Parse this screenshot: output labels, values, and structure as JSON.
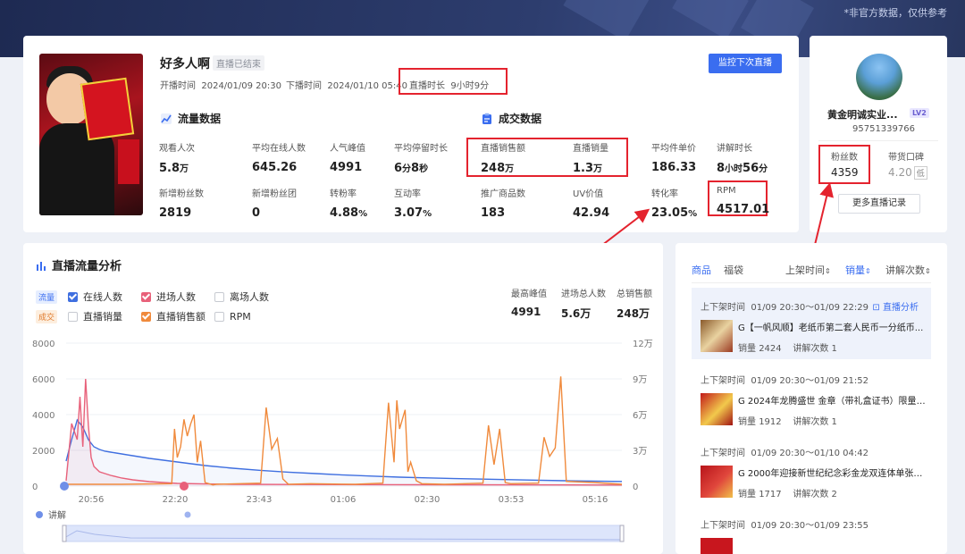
{
  "top_note": "*非官方数据，仅供参考",
  "live": {
    "title": "好多人啊",
    "status": "直播已结束",
    "start_label": "开播时间",
    "start": "2024/01/09 20:30",
    "end_label": "下播时间",
    "end": "2024/01/10 05:40",
    "duration_label": "直播时长",
    "duration": "9小时9分",
    "monitor_button": "监控下次直播"
  },
  "traffic": {
    "title": "流量数据",
    "stats": [
      {
        "label": "观看人次",
        "num": "5.8",
        "unit": "万"
      },
      {
        "label": "平均在线人数",
        "num": "645.26",
        "unit": ""
      },
      {
        "label": "人气峰值",
        "num": "4991",
        "unit": ""
      },
      {
        "label": "平均停留时长",
        "num": "6",
        "unit": "分",
        "num2": "8",
        "unit2": "秒"
      },
      {
        "label": "新增粉丝数",
        "num": "2819",
        "unit": ""
      },
      {
        "label": "新增粉丝团",
        "num": "0",
        "unit": ""
      },
      {
        "label": "转粉率",
        "num": "4.88",
        "unit": "%"
      },
      {
        "label": "互动率",
        "num": "3.07",
        "unit": "%"
      }
    ]
  },
  "deal": {
    "title": "成交数据",
    "stats": [
      {
        "label": "直播销售额",
        "num": "248",
        "unit": "万"
      },
      {
        "label": "直播销量",
        "num": "1.3",
        "unit": "万"
      },
      {
        "label": "平均件单价",
        "num": "186.33",
        "unit": ""
      },
      {
        "label": "讲解时长",
        "num": "8",
        "unit": "小时",
        "num2": "56",
        "unit2": "分"
      },
      {
        "label": "推广商品数",
        "num": "183",
        "unit": ""
      },
      {
        "label": "UV价值",
        "num": "42.94",
        "unit": ""
      },
      {
        "label": "转化率",
        "num": "23.05",
        "unit": "%"
      },
      {
        "label": "RPM",
        "num": "4517.01",
        "unit": ""
      }
    ]
  },
  "streamer": {
    "name": "黄金明诚实业...",
    "level": "LV2",
    "id": "95751339766",
    "fans_label": "粉丝数",
    "fans": "4359",
    "reputation_label": "带货口碑",
    "reputation": "4.20",
    "reputation_tag": "低",
    "more_button": "更多直播记录"
  },
  "chart": {
    "title": "直播流量分析",
    "tag_traffic": "流量",
    "tag_deal": "成交",
    "legend_row1": [
      "在线人数",
      "进场人数",
      "离场人数"
    ],
    "legend_row2": [
      "直播销量",
      "直播销售额",
      "RPM"
    ],
    "summary": [
      {
        "label": "最高峰值",
        "value": "4991"
      },
      {
        "label": "进场总人数",
        "value": "5.6万"
      },
      {
        "label": "总销售额",
        "value": "248万"
      }
    ],
    "explain_label": "讲解",
    "colors": {
      "online": "#3f6fe0",
      "enter": "#e8617a",
      "sales": "#f08a3c"
    }
  },
  "chart_data": {
    "type": "line",
    "x_ticks": [
      "20:56",
      "22:20",
      "23:43",
      "01:06",
      "02:30",
      "03:53",
      "05:16"
    ],
    "y_left_ticks": [
      "0",
      "2000",
      "4000",
      "6000",
      "8000"
    ],
    "y_right_ticks": [
      "0",
      "3万",
      "6万",
      "9万",
      "12万"
    ],
    "ylim_left": [
      0,
      8000
    ],
    "ylim_right": [
      0,
      120000
    ],
    "series": [
      {
        "name": "在线人数",
        "axis": "left",
        "x": [
          0,
          1,
          2,
          3,
          4,
          5,
          6,
          7,
          8,
          10,
          12,
          15,
          20,
          25,
          30,
          35,
          40,
          45,
          50,
          55,
          60,
          65,
          70,
          75,
          80,
          85,
          90,
          95,
          100
        ],
        "values": [
          1400,
          2600,
          3700,
          3300,
          2600,
          2200,
          2050,
          1950,
          1900,
          1800,
          1700,
          1550,
          1350,
          1150,
          1000,
          880,
          780,
          700,
          620,
          560,
          500,
          460,
          420,
          390,
          360,
          330,
          300,
          280,
          260
        ]
      },
      {
        "name": "进场人数",
        "axis": "left",
        "x": [
          0,
          1,
          2,
          2.5,
          3,
          3.5,
          4,
          4.5,
          5,
          6,
          7,
          8,
          10,
          12,
          15,
          20,
          25,
          30,
          40,
          60,
          80,
          100
        ],
        "values": [
          300,
          3500,
          2600,
          5000,
          2200,
          6000,
          3400,
          1600,
          1100,
          800,
          700,
          600,
          450,
          350,
          250,
          150,
          120,
          100,
          90,
          80,
          70,
          60
        ]
      },
      {
        "name": "直播销售额",
        "axis": "right",
        "x": [
          0,
          10,
          19,
          19.5,
          20,
          20.6,
          21.2,
          21.8,
          22.4,
          23,
          23.6,
          24.2,
          25,
          26.4,
          27,
          35,
          36,
          37,
          38,
          39,
          40,
          44,
          52,
          57,
          58,
          59,
          59.5,
          60,
          61,
          61.5,
          62,
          63,
          64,
          68,
          75,
          76,
          77,
          78,
          79,
          80,
          85,
          86,
          87,
          88,
          89,
          90,
          95,
          100
        ],
        "values": [
          1500,
          1500,
          2000,
          48000,
          24000,
          33000,
          56000,
          42000,
          52000,
          60000,
          20000,
          38000,
          3000,
          1000,
          1500,
          2500,
          66000,
          31000,
          40000,
          6000,
          1500,
          2000,
          1500,
          2500,
          70000,
          20000,
          72000,
          48000,
          64000,
          12000,
          20000,
          4500,
          2000,
          1500,
          2500,
          51000,
          18000,
          48000,
          3000,
          2000,
          2500,
          41000,
          25000,
          32000,
          92000,
          4000,
          3000,
          1500
        ]
      }
    ]
  },
  "products": {
    "tabs": [
      "商品",
      "福袋"
    ],
    "sorts": [
      "上架时间",
      "销量",
      "讲解次数"
    ],
    "analysis_link": "直播分析",
    "items": [
      {
        "time_label": "上下架时间",
        "time": "01/09 20:30～01/09 22:29",
        "name": "G【一帆风顺】老纸币第二套人民币一分纸币...",
        "sales_label": "销量",
        "sales": "2424",
        "explain_label": "讲解次数",
        "explain": "1"
      },
      {
        "time_label": "上下架时间",
        "time": "01/09 20:30～01/09 21:52",
        "name": "G 2024年龙腾盛世 金章（带礼盒证书）限量2...",
        "sales_label": "销量",
        "sales": "1912",
        "explain_label": "讲解次数",
        "explain": "1"
      },
      {
        "time_label": "上下架时间",
        "time": "01/09 20:30～01/10 04:42",
        "name": "G 2000年迎接新世纪纪念彩金龙双连体单张封...",
        "sales_label": "销量",
        "sales": "1717",
        "explain_label": "讲解次数",
        "explain": "2"
      },
      {
        "time_label": "上下架时间",
        "time": "01/09 20:30～01/09 23:55",
        "name": "",
        "sales_label": "",
        "sales": "",
        "explain_label": "",
        "explain": ""
      }
    ]
  }
}
